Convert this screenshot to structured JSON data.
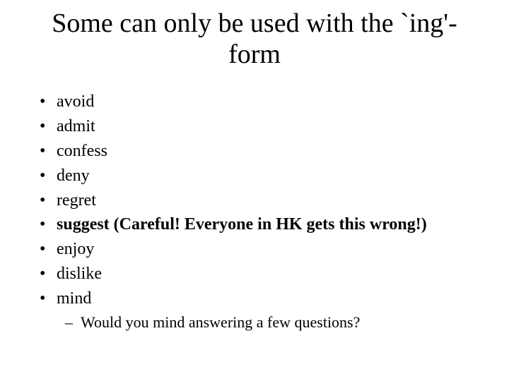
{
  "title": "Some can only be used with the `ing'-form",
  "items": [
    {
      "text": "avoid",
      "bold": false
    },
    {
      "text": "admit",
      "bold": false
    },
    {
      "text": "confess",
      "bold": false
    },
    {
      "text": "deny",
      "bold": false
    },
    {
      "text": "regret",
      "bold": false
    },
    {
      "text": "suggest",
      "bold": true,
      "note": "(Careful! Everyone in HK gets this wrong!)"
    },
    {
      "text": "enjoy",
      "bold": false
    },
    {
      "text": "dislike",
      "bold": false
    },
    {
      "text": "mind",
      "bold": false,
      "sub": [
        "Would you mind answering a few questions?"
      ]
    }
  ]
}
